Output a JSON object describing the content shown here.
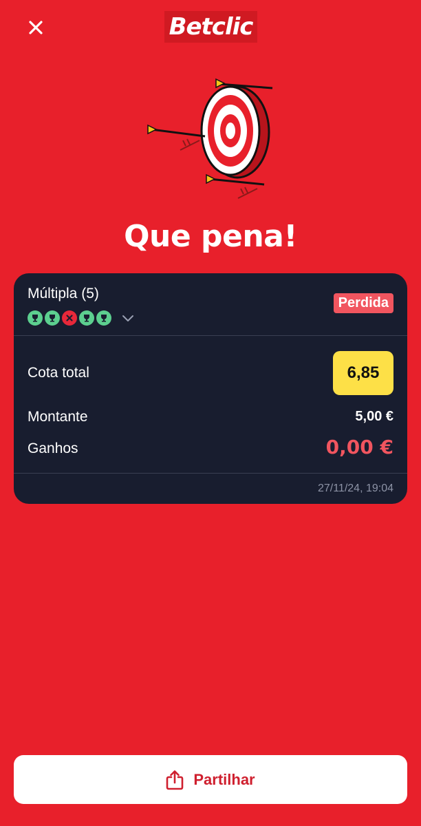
{
  "header": {
    "logo_text": "Betclic",
    "close_icon": "close-icon"
  },
  "headline": "Que pena!",
  "bet": {
    "type_label": "Múltipla (5)",
    "status": "Perdida",
    "legs": [
      "won",
      "won",
      "lost",
      "won",
      "won"
    ],
    "odds_label": "Cota total",
    "odds_value": "6,85",
    "stake_label": "Montante",
    "stake_value": "5,00 €",
    "winnings_label": "Ganhos",
    "winnings_value": "0,00 €",
    "timestamp": "27/11/24, 19:04"
  },
  "share": {
    "label": "Partilhar",
    "icon": "share-icon"
  },
  "colors": {
    "background": "#e8202b",
    "card": "#181d2f",
    "won": "#5ccf8f",
    "lost": "#e8283a",
    "odds": "#fde047",
    "loss_text": "#f1555f"
  }
}
